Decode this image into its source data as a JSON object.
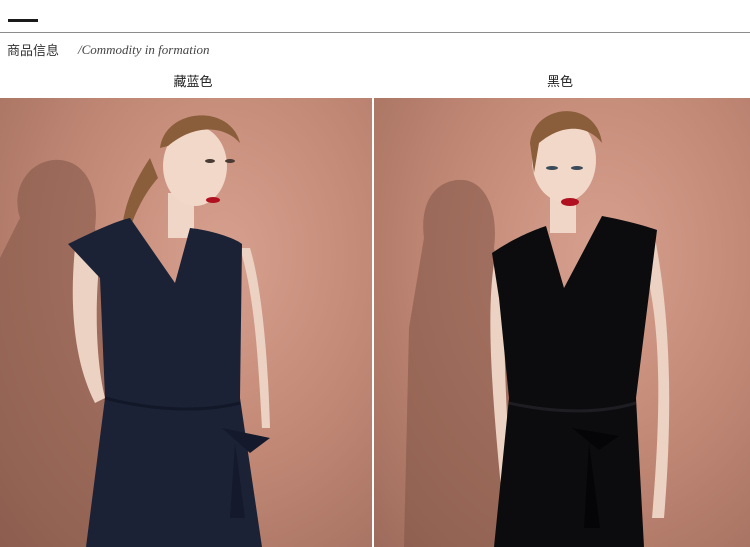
{
  "header": {
    "section_title_cn": "商品信息",
    "section_title_en": "/Commodity in formation"
  },
  "variants": [
    {
      "color_label": "藏蓝色",
      "dress_color": "#1b2236"
    },
    {
      "color_label": "黑色",
      "dress_color": "#0c0c0e"
    }
  ],
  "colors": {
    "background_wall": "#c48a78",
    "skin": "#efd6c6",
    "hair": "#8a5e3a",
    "lips": "#b01020"
  }
}
